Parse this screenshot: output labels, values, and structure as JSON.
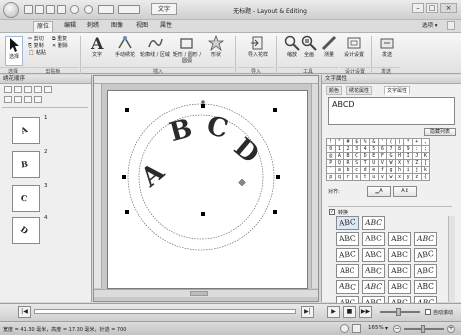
{
  "window": {
    "title": "无标题 - Layout & Editing"
  },
  "titlebar": {
    "text_tag": "文字",
    "min": "–",
    "max": "□",
    "close": "×"
  },
  "tabs": [
    "原位",
    "编辑",
    "刺绣",
    "图像",
    "视图",
    "属性"
  ],
  "options_label": "选项 ▾",
  "ribbon": {
    "select": "选择",
    "clipboard": [
      "剪切",
      "复制",
      "粘贴"
    ],
    "clipboard_dup": "重复",
    "clipboard_del": "删除",
    "create": [
      "文字",
      "手动绣花",
      "轮廓线 / 区域",
      "矩形 / 圆形 / 圆弧",
      "形状"
    ],
    "import": [
      "导入花样"
    ],
    "tools": [
      "缩放",
      "全画",
      "测量",
      "设计设置"
    ],
    "design_settings": "设计设置",
    "sew": "发送",
    "groups": [
      "选择",
      "剪贴板",
      "插入",
      "导入",
      "工具",
      "设计设置",
      "发送"
    ]
  },
  "left_panel": {
    "title": "绣花顺序",
    "thumbs": [
      {
        "num": "1",
        "letter": "A"
      },
      {
        "num": "2",
        "letter": "B"
      },
      {
        "num": "3",
        "letter": "C"
      },
      {
        "num": "4",
        "letter": "D"
      }
    ]
  },
  "right_panel": {
    "title": "文字属性",
    "tabs": [
      "颜色",
      "绣花属性",
      "文字属性"
    ],
    "text_value": "ABCD",
    "hide_list": "隐藏列表",
    "char_rows": [
      [
        "!",
        "\"",
        "#",
        "$",
        "%",
        "&",
        "'",
        "(",
        ")",
        "*",
        "+",
        ","
      ],
      [
        "0",
        "1",
        "2",
        "3",
        "4",
        "5",
        "6",
        "7",
        "8",
        "9",
        ":",
        ";"
      ],
      [
        "@",
        "A",
        "B",
        "C",
        "D",
        "E",
        "F",
        "G",
        "H",
        "I",
        "J",
        "K"
      ],
      [
        "P",
        "Q",
        "R",
        "S",
        "T",
        "U",
        "V",
        "W",
        "X",
        "Y",
        "Z",
        "["
      ],
      [
        "`",
        "a",
        "b",
        "c",
        "d",
        "e",
        "f",
        "g",
        "h",
        "i",
        "j",
        "k"
      ],
      [
        "p",
        "q",
        "r",
        "s",
        "t",
        "u",
        "v",
        "w",
        "x",
        "y",
        "z",
        "{"
      ]
    ],
    "align_label": "对齐:",
    "transform_label": "转换",
    "style_label": "ABC"
  },
  "canvas_text": "ABCD",
  "timeline": {
    "auto_scroll": "自动滚动"
  },
  "status": {
    "text": "宽度 = 41.30 毫米，高度 = 17.30 毫米，针迹 = 700",
    "zoom": "165%"
  }
}
